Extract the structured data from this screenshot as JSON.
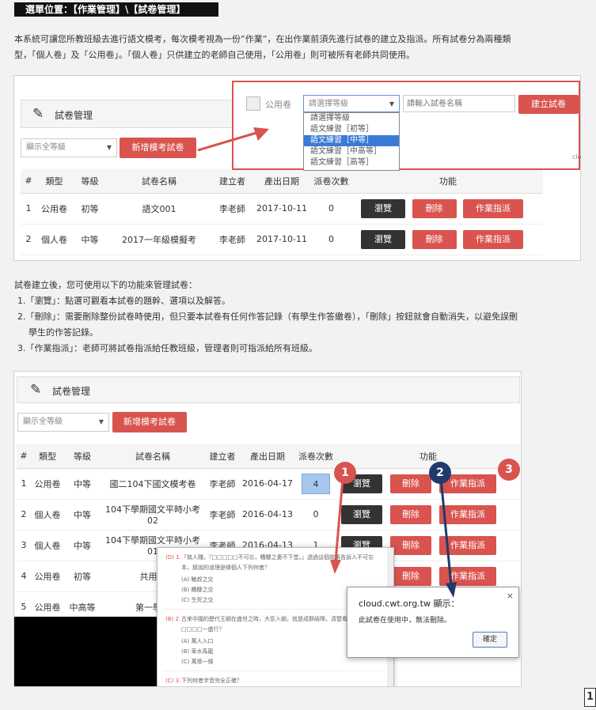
{
  "header": {
    "path": "選單位置：【作業管理】\\【試卷管理】"
  },
  "intro": {
    "line1": "本系統可讓您所教班級去進行語文模考，每次模考視為一份”作業”，在出作業前須先進行試卷的建立及指派。所有試卷分為兩種類",
    "line2": "型，「個人卷」及「公用卷」。「個人卷」只供建立的老師自己使用，「公用卷」則可被所有老師共同使用。"
  },
  "shot1": {
    "panel_title": "試卷管理",
    "filter_select": "顯示全等級",
    "add_button": "新增模考試卷",
    "popup": {
      "checkbox_label": "公用卷",
      "level_select": "請選擇等級",
      "name_placeholder": "請輸入試卷名稱",
      "create_button": "建立試卷",
      "close_text": "clo",
      "options": [
        "請選擇等級",
        "語文練習［初等］",
        "語文練習［中等］",
        "語文練習［中高等］",
        "語文練習［高等］"
      ]
    },
    "columns": [
      "#",
      "類型",
      "等級",
      "試卷名稱",
      "建立者",
      "產出日期",
      "派卷次數",
      "功能"
    ],
    "rows": [
      {
        "no": "1",
        "type": "公用卷",
        "level": "初等",
        "name": "語文001",
        "creator": "李老師",
        "date": "2017-10-11",
        "count": "0"
      },
      {
        "no": "2",
        "type": "個人卷",
        "level": "中等",
        "name": "2017一年級模擬考",
        "creator": "李老師",
        "date": "2017-10-11",
        "count": "0"
      }
    ],
    "actions": {
      "view": "瀏覽",
      "delete": "刪除",
      "assign": "作業指派"
    }
  },
  "usage": {
    "intro": "試卷建立後，您可使用以下的功能來管理試卷：",
    "item1": "1.「瀏覽」：點選可觀看本試卷的題幹、選項以及解答。",
    "item2a": "2.「刪除」：需要刪除整份試卷時使用，但只要本試卷有任何作答記錄（有學生作答繳卷），「刪除」按鈕就會自動消失，以避免誤刪",
    "item2b": "學生的作答記錄。",
    "item3": "3.「作業指派」：老師可將試卷指派給任教班級，管理者則可指派給所有班級。"
  },
  "shot2": {
    "panel_title": "試卷管理",
    "filter_select": "顯示全等級",
    "add_button": "新增模考試卷",
    "columns": [
      "#",
      "類型",
      "等級",
      "試卷名稱",
      "建立者",
      "產出日期",
      "派卷次數",
      "功能"
    ],
    "rows": [
      {
        "no": "1",
        "type": "公用卷",
        "level": "中等",
        "name": "國二104下國文模考卷",
        "creator": "李老師",
        "date": "2016-04-17",
        "count": "4"
      },
      {
        "no": "2",
        "type": "個人卷",
        "level": "中等",
        "name": "104下學期國文平時小考02",
        "creator": "李老師",
        "date": "2016-04-13",
        "count": "0"
      },
      {
        "no": "3",
        "type": "個人卷",
        "level": "中等",
        "name": "104下學期國文平時小考01",
        "creator": "李老師",
        "date": "2016-04-13",
        "count": "1"
      },
      {
        "no": "4",
        "type": "公用卷",
        "level": "初等",
        "name": "共用卷",
        "creator": "",
        "date": "",
        "count": ""
      },
      {
        "no": "5",
        "type": "公用卷",
        "level": "中高等",
        "name": "第一學期",
        "creator": "",
        "date": "",
        "count": ""
      }
    ],
    "actions": {
      "view": "瀏覽",
      "delete": "刪除",
      "assign": "作業指派"
    },
    "badges": [
      "1",
      "2",
      "3"
    ],
    "dialog": {
      "title": "cloud.cwt.org.tw 顯示：",
      "message": "此試卷在使用中，無法刪除。",
      "ok": "確定",
      "close": "×"
    },
    "preview": {
      "q1_label": "(D) 1.",
      "q1_text": "「故人賤，『□□□□□不可忘，糟糠之妻不下堂。』透過這個故事告訴人不可忘本，那說的道理是哪個人下列何者？",
      "q1_options": [
        "(A) 鮑叔之交",
        "(B) 糟糠之交",
        "(C) 生死之交",
        "(D) 莫逆之交"
      ],
      "q2_label": "(B) 2.",
      "q2_text": "古來中國的歷代王朝在盛世之時，大臣入朝，就是成群結隊，清楚看見，可說□□□□一盛行？",
      "q2_options": [
        "(A) 萬人入口",
        "(B) 車水馬龍",
        "(C) 萬眾一條",
        "(D) 萬人雲集"
      ],
      "q3_label": "(C) 3.",
      "q3_text": "下列何者字音完全正確？"
    }
  },
  "page_number": "1",
  "colors": {
    "red": "#d9534f",
    "dark": "#333333",
    "highlight": "#a6c8ec",
    "arrow_red": "#d9534f",
    "arrow_navy": "#1f3a6b"
  }
}
